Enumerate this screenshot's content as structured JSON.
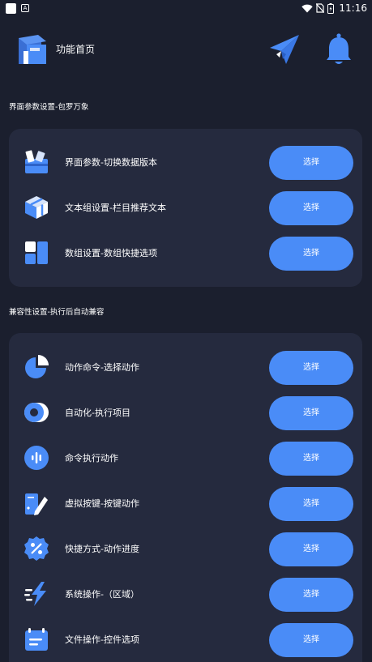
{
  "status_bar": {
    "time": "11:16",
    "a_badge": "A"
  },
  "header": {
    "title": "功能首页"
  },
  "section1": {
    "title": "界面参数设置-包罗万象",
    "items": [
      {
        "label": "界面参数-切换数据版本",
        "button": "选择",
        "icon": "toolbox-icon"
      },
      {
        "label": "文本组设置-栏目推荐文本",
        "button": "选择",
        "icon": "cube-icon"
      },
      {
        "label": "数组设置-数组快捷选项",
        "button": "选择",
        "icon": "layout-grid-icon"
      }
    ]
  },
  "section2": {
    "title": "兼容性设置-执行后自动兼容",
    "items": [
      {
        "label": "动作命令-选择动作",
        "button": "选择",
        "icon": "pie-chart-icon"
      },
      {
        "label": "自动化-执行项目",
        "button": "选择",
        "icon": "toggle-icon"
      },
      {
        "label": "命令执行动作",
        "button": "选择",
        "icon": "audio-wave-icon"
      },
      {
        "label": "虚拟按键-按键动作",
        "button": "选择",
        "icon": "edit-sparkle-icon"
      },
      {
        "label": "快捷方式-动作进度",
        "button": "选择",
        "icon": "percent-badge-icon"
      },
      {
        "label": "系统操作-（区域）",
        "button": "选择",
        "icon": "lightning-icon"
      },
      {
        "label": "文件操作-控件选项",
        "button": "选择",
        "icon": "document-icon"
      }
    ]
  },
  "colors": {
    "background": "#1b1f2e",
    "card": "#252a3e",
    "accent": "#4a8cf7"
  }
}
